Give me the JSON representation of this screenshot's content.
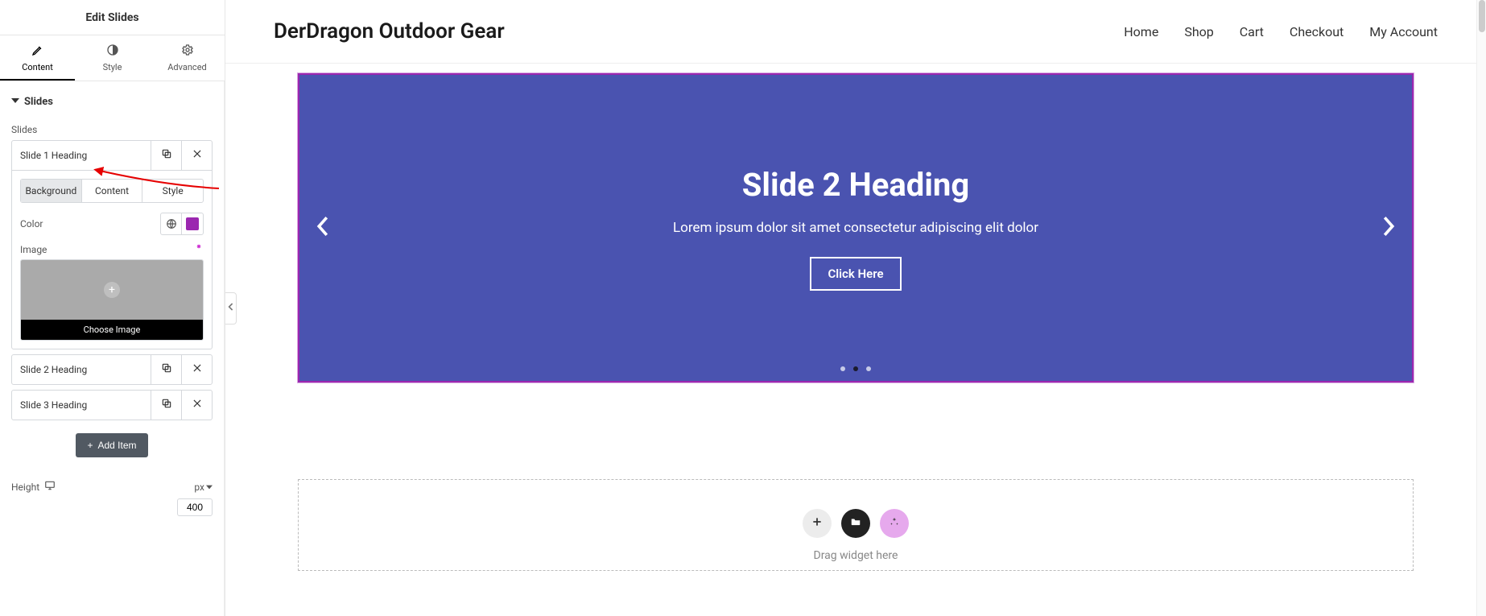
{
  "panel": {
    "title": "Edit Slides",
    "modeTabs": [
      {
        "label": "Content",
        "active": true
      },
      {
        "label": "Style",
        "active": false
      },
      {
        "label": "Advanced",
        "active": false
      }
    ],
    "section": {
      "title": "Slides"
    },
    "repeaterLabel": "Slides",
    "slides": [
      {
        "title": "Slide 1 Heading",
        "expanded": true
      },
      {
        "title": "Slide 2 Heading",
        "expanded": false
      },
      {
        "title": "Slide 3 Heading",
        "expanded": false
      }
    ],
    "subTabs": [
      {
        "label": "Background",
        "active": true
      },
      {
        "label": "Content",
        "active": false
      },
      {
        "label": "Style",
        "active": false
      }
    ],
    "colorLabel": "Color",
    "colorSwatch": "#9b27b0",
    "imageLabel": "Image",
    "chooseImage": "Choose Image",
    "addItem": "Add Item",
    "heightLabel": "Height",
    "heightUnit": "px",
    "heightValue": "400"
  },
  "site": {
    "brand": "DerDragon Outdoor Gear",
    "nav": [
      "Home",
      "Shop",
      "Cart",
      "Checkout",
      "My Account"
    ]
  },
  "slide": {
    "heading": "Slide 2 Heading",
    "sub": "Lorem ipsum dolor sit amet consectetur adipiscing elit dolor",
    "button": "Click Here",
    "activeDot": 1,
    "dotCount": 3
  },
  "drop": {
    "label": "Drag widget here"
  }
}
